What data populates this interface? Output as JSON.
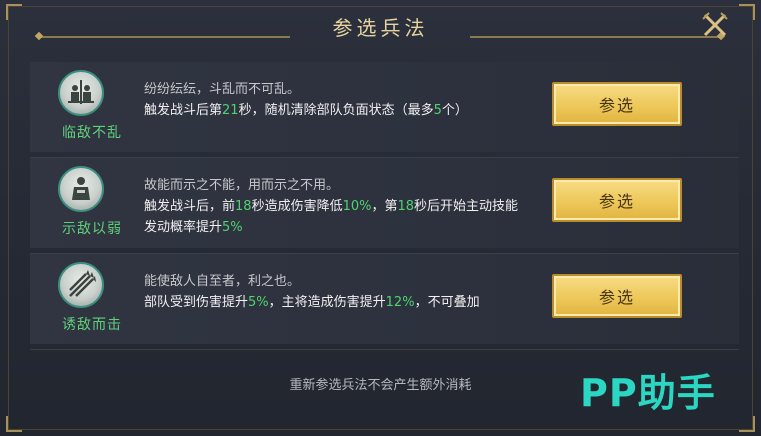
{
  "dialog": {
    "title": "参选兵法",
    "close_icon": "close-swords-icon",
    "footer_note": "重新参选兵法不会产生额外消耗"
  },
  "tactics": [
    {
      "name": "临敌不乱",
      "icon": "soldiers-formation-icon",
      "quote": "纷纷纭纭，斗乱而不可乱。",
      "effect_parts": [
        "触发战斗后第",
        "21",
        "秒，随机清除部队负面状态（最多",
        "5",
        "个）"
      ],
      "button": "参选"
    },
    {
      "name": "示敌以弱",
      "icon": "soldier-figure-icon",
      "quote": "故能而示之不能，用而示之不用。",
      "effect_parts": [
        "触发战斗后，前",
        "18",
        "秒造成伤害降低",
        "10%",
        "，第",
        "18",
        "秒后开始主动技能发动概率提升",
        "5%"
      ],
      "button": "参选"
    },
    {
      "name": "诱敌而击",
      "icon": "arrows-volley-icon",
      "quote": "能使敌人自至者，利之也。",
      "effect_parts": [
        "部队受到伤害提升",
        "5%",
        "，主将造成伤害提升",
        "12%",
        "，不可叠加"
      ],
      "button": "参选"
    }
  ],
  "watermark": "PP助手",
  "colors": {
    "highlight": "#4fd36e",
    "tactic_name": "#5fd07a",
    "button_gold": "#edc85a",
    "title_gold": "#e6d3a0"
  }
}
